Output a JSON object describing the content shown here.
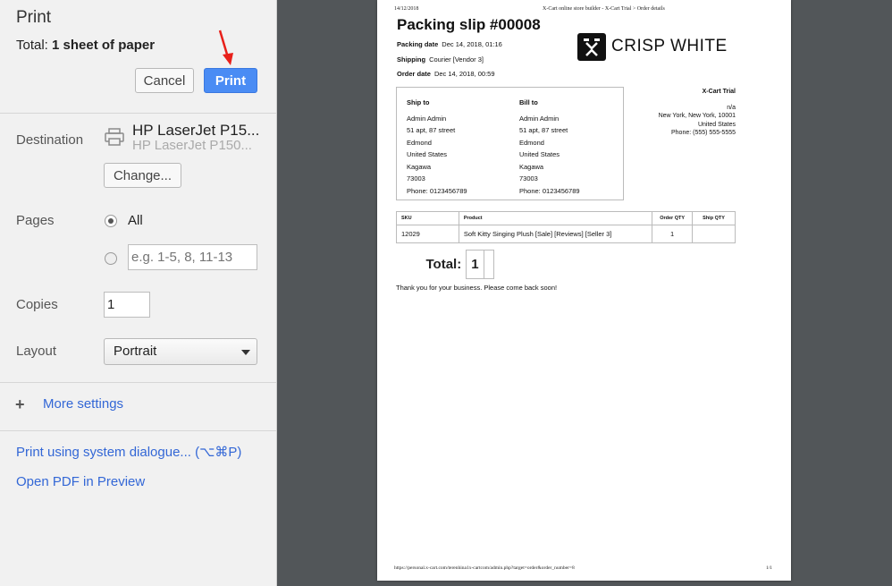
{
  "dialog": {
    "title": "Print",
    "total_prefix": "Total: ",
    "total_value": "1 sheet of paper",
    "cancel_label": "Cancel",
    "print_label": "Print",
    "destination_label": "Destination",
    "destination_name": "HP LaserJet P15...",
    "destination_sub": "HP LaserJet P150...",
    "change_label": "Change...",
    "pages_label": "Pages",
    "pages_all_label": "All",
    "pages_placeholder": "e.g. 1-5, 8, 11-13",
    "copies_label": "Copies",
    "copies_value": "1",
    "layout_label": "Layout",
    "layout_value": "Portrait",
    "more_settings_label": "More settings",
    "system_dialogue_label": "Print using system dialogue... (⌥⌘P)",
    "open_pdf_label": "Open PDF in Preview",
    "accent_color": "#4a8cf4",
    "arrow_color": "#e8201a"
  },
  "preview": {
    "header_date": "14/12/2018",
    "header_title": "X-Cart online store builder - X-Cart Trial > Order details",
    "title": "Packing slip #00008",
    "packing_date_label": "Packing date",
    "packing_date_value": "Dec 14, 2018, 01:16",
    "shipping_label": "Shipping",
    "shipping_value": "Courier [Vendor 3]",
    "order_date_label": "Order date",
    "order_date_value": "Dec 14, 2018, 00:59",
    "logo_text": "CRISP WHITE",
    "ship_to": {
      "heading": "Ship to",
      "lines": [
        "Admin Admin",
        "51 apt, 87 street",
        "Edmond",
        "United States",
        "Kagawa",
        "73003",
        "Phone: 0123456789"
      ]
    },
    "bill_to": {
      "heading": "Bill to",
      "lines": [
        "Admin Admin",
        "51 apt, 87 street",
        "Edmond",
        "United States",
        "Kagawa",
        "73003",
        "Phone: 0123456789"
      ]
    },
    "company": {
      "name": "X-Cart Trial",
      "lines": [
        "n/a",
        "New York, New York, 10001",
        "United States",
        "Phone: (555) 555-5555"
      ]
    },
    "table": {
      "headers": [
        "SKU",
        "Product",
        "Order QTY",
        "Ship QTY"
      ],
      "row": [
        "12029",
        "Soft Kitty Singing Plush [Sale] [Reviews] [Seller 3]",
        "1",
        ""
      ],
      "total_label": "Total:",
      "total_value": "1"
    },
    "thanks": "Thank you for your business. Please come back soon!",
    "footer_url": "https://personal.x-cart.com/terenhina1x-cartcom/admin.php?target=order&order_number=8",
    "footer_page": "1/1"
  }
}
